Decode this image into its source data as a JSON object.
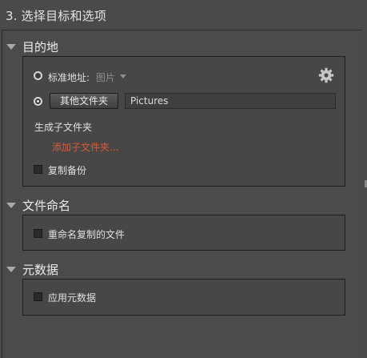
{
  "page": {
    "title": "3. 选择目标和选项"
  },
  "colors": {
    "background": "#4a4a4a",
    "link": "#e05a34"
  },
  "sections": {
    "destination": {
      "header": "目的地",
      "standard_address_label": "标准地址:",
      "standard_address_value": "图片",
      "other_folder_button": "其他文件夹",
      "path_value": "Pictures",
      "subfolder_label": "生成子文件夹",
      "add_subfolder_link": "添加子文件夹...",
      "backup_label": "复制备份",
      "selected_option": "other_folder",
      "backup_checked": false
    },
    "file_naming": {
      "header": "文件命名",
      "rename_label": "重命名复制的文件",
      "rename_checked": false
    },
    "metadata": {
      "header": "元数据",
      "apply_label": "应用元数据",
      "apply_checked": false
    }
  },
  "icons": {
    "settings": "gear-icon",
    "collapse": "triangle-down-icon"
  }
}
